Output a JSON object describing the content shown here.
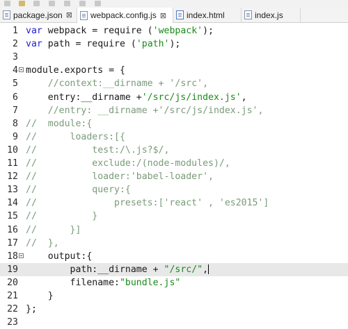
{
  "tabs": [
    {
      "label": "package.json",
      "close": "⊠",
      "active": false
    },
    {
      "label": "webpack.config.js",
      "close": "⊠",
      "active": true
    },
    {
      "label": "index.html",
      "close": "",
      "active": false
    },
    {
      "label": "index.js",
      "close": "",
      "active": false
    }
  ],
  "lines": [
    {
      "n": "1",
      "tokens": [
        [
          "kw",
          "var"
        ],
        [
          "txt",
          " webpack = require ("
        ],
        [
          "str",
          "'webpack'"
        ],
        [
          "txt",
          ");"
        ]
      ]
    },
    {
      "n": "2",
      "tokens": [
        [
          "kw",
          "var"
        ],
        [
          "txt",
          " path = require ("
        ],
        [
          "str",
          "'path'"
        ],
        [
          "txt",
          ");"
        ]
      ]
    },
    {
      "n": "3",
      "tokens": []
    },
    {
      "n": "4",
      "fold": true,
      "tokens": [
        [
          "txt",
          "module.exports = {"
        ]
      ]
    },
    {
      "n": "5",
      "tokens": [
        [
          "txt",
          "    "
        ],
        [
          "cmt",
          "//context:__dirname + '/src',"
        ]
      ]
    },
    {
      "n": "6",
      "tokens": [
        [
          "txt",
          "    entry:__dirname +"
        ],
        [
          "str",
          "'/src/js/index.js'"
        ],
        [
          "txt",
          ","
        ]
      ]
    },
    {
      "n": "7",
      "tokens": [
        [
          "txt",
          "    "
        ],
        [
          "cmt",
          "//entry: __dirname +'/src/js/index.js',"
        ]
      ]
    },
    {
      "n": "8",
      "tokens": [
        [
          "cmt",
          "//  module:{"
        ]
      ]
    },
    {
      "n": "9",
      "tokens": [
        [
          "cmt",
          "//      loaders:[{"
        ]
      ]
    },
    {
      "n": "10",
      "tokens": [
        [
          "cmt",
          "//          test:/\\.js?$/,"
        ]
      ]
    },
    {
      "n": "11",
      "tokens": [
        [
          "cmt",
          "//          exclude:/(node-modules)/,"
        ]
      ]
    },
    {
      "n": "12",
      "tokens": [
        [
          "cmt",
          "//          loader:'babel-loader',"
        ]
      ]
    },
    {
      "n": "13",
      "tokens": [
        [
          "cmt",
          "//          query:{"
        ]
      ]
    },
    {
      "n": "14",
      "tokens": [
        [
          "cmt",
          "//              presets:['react' , 'es2015']"
        ]
      ]
    },
    {
      "n": "15",
      "tokens": [
        [
          "cmt",
          "//          }"
        ]
      ]
    },
    {
      "n": "16",
      "tokens": [
        [
          "cmt",
          "//      }]"
        ]
      ]
    },
    {
      "n": "17",
      "tokens": [
        [
          "cmt",
          "//  },"
        ]
      ]
    },
    {
      "n": "18",
      "fold": true,
      "tokens": [
        [
          "txt",
          "    output:{"
        ]
      ]
    },
    {
      "n": "19",
      "current": true,
      "cursor": true,
      "tokens": [
        [
          "txt",
          "        path:__dirname + "
        ],
        [
          "str",
          "\"/src/\""
        ],
        [
          "txt",
          ","
        ]
      ]
    },
    {
      "n": "20",
      "tokens": [
        [
          "txt",
          "        filename:"
        ],
        [
          "str",
          "\"bundle.js\""
        ]
      ]
    },
    {
      "n": "21",
      "tokens": [
        [
          "txt",
          "    }"
        ]
      ]
    },
    {
      "n": "22",
      "tokens": [
        [
          "txt",
          "};"
        ]
      ]
    },
    {
      "n": "23",
      "tokens": []
    }
  ]
}
